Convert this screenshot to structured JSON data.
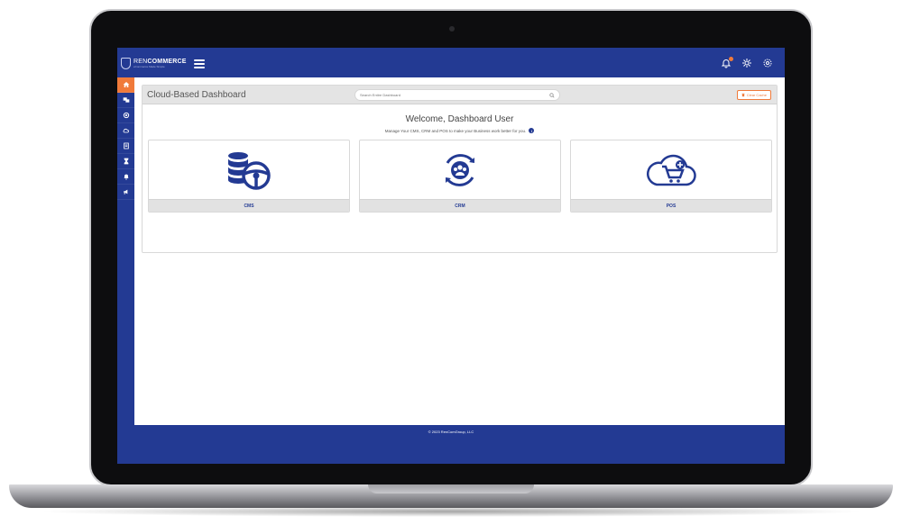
{
  "app": {
    "brand_prefix": "REN",
    "brand_suffix": "COMMERCE",
    "brand_tagline": "eCommerce Made Simple"
  },
  "topbar": {
    "icons": [
      "bell-icon",
      "network-gear-icon",
      "settings-icon"
    ]
  },
  "sidebar": {
    "items": [
      {
        "icon": "home-icon",
        "active": true
      },
      {
        "icon": "dashboard-icon"
      },
      {
        "icon": "integrations-icon"
      },
      {
        "icon": "cloud-icon"
      },
      {
        "icon": "document-icon"
      },
      {
        "icon": "hourglass-icon"
      },
      {
        "icon": "bell-icon"
      },
      {
        "icon": "megaphone-icon"
      }
    ]
  },
  "panel": {
    "title": "Cloud-Based Dashboard",
    "search_placeholder": "Search Entire Dashboard",
    "clear_cache_label": "Clear Cache"
  },
  "welcome": {
    "heading": "Welcome, Dashboard User",
    "subtext": "Manage Your CMS, CRM and POS to make your Business work better for you."
  },
  "cards": [
    {
      "label": "CMS",
      "icon": "database-steering-wheel-icon"
    },
    {
      "label": "CRM",
      "icon": "people-cycle-icon"
    },
    {
      "label": "POS",
      "icon": "cloud-cart-icon"
    }
  ],
  "footer": {
    "copyright": "© 2023 RenComGroup, LLC"
  },
  "colors": {
    "brand_blue": "#233a93",
    "accent_orange": "#f07a3a"
  }
}
